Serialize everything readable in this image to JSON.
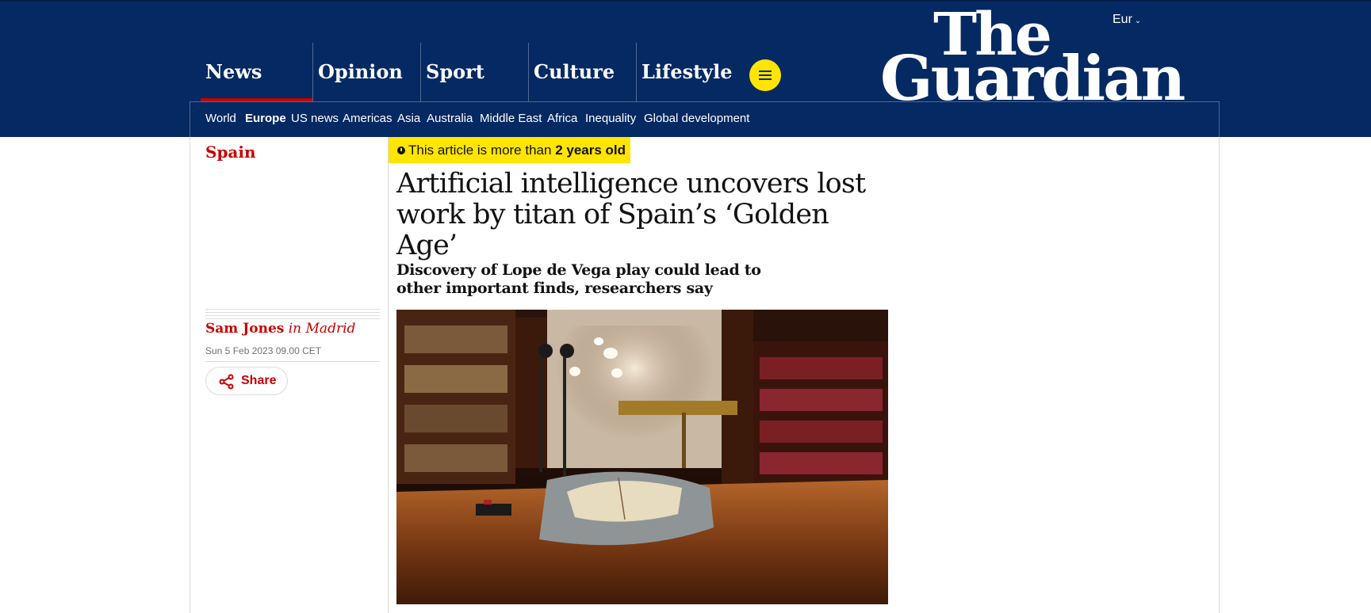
{
  "header": {
    "edition": "Eur",
    "logo_line1": "The",
    "logo_line2": "Guardian",
    "pillars": [
      {
        "label": "News",
        "active": true
      },
      {
        "label": "Opinion"
      },
      {
        "label": "Sport"
      },
      {
        "label": "Culture"
      },
      {
        "label": "Lifestyle"
      }
    ],
    "menu_icon": "hamburger-icon"
  },
  "subnav": [
    {
      "label": "World"
    },
    {
      "label": "Europe",
      "active": true
    },
    {
      "label": "US news"
    },
    {
      "label": "Americas"
    },
    {
      "label": "Asia"
    },
    {
      "label": "Australia"
    },
    {
      "label": "Middle East"
    },
    {
      "label": "Africa"
    },
    {
      "label": "Inequality"
    },
    {
      "label": "Global development"
    }
  ],
  "article": {
    "section": "Spain",
    "age_warning_prefix": "This article is more than ",
    "age_warning_bold": "2 years old",
    "headline": "Artificial intelligence uncovers lost work by titan of Spain’s ‘Golden Age’",
    "standfirst": "Discovery of Lope de Vega play could lead to other important finds, researchers say",
    "author": "Sam Jones",
    "location": "in Madrid",
    "date": "Sun 5 Feb 2023 09.00 CET",
    "share_label": "Share",
    "share_icon": "share-icon",
    "image_icon": "library-photo"
  },
  "colors": {
    "brand": "#052962",
    "news_red": "#c70000",
    "highlight": "#ffe500"
  }
}
